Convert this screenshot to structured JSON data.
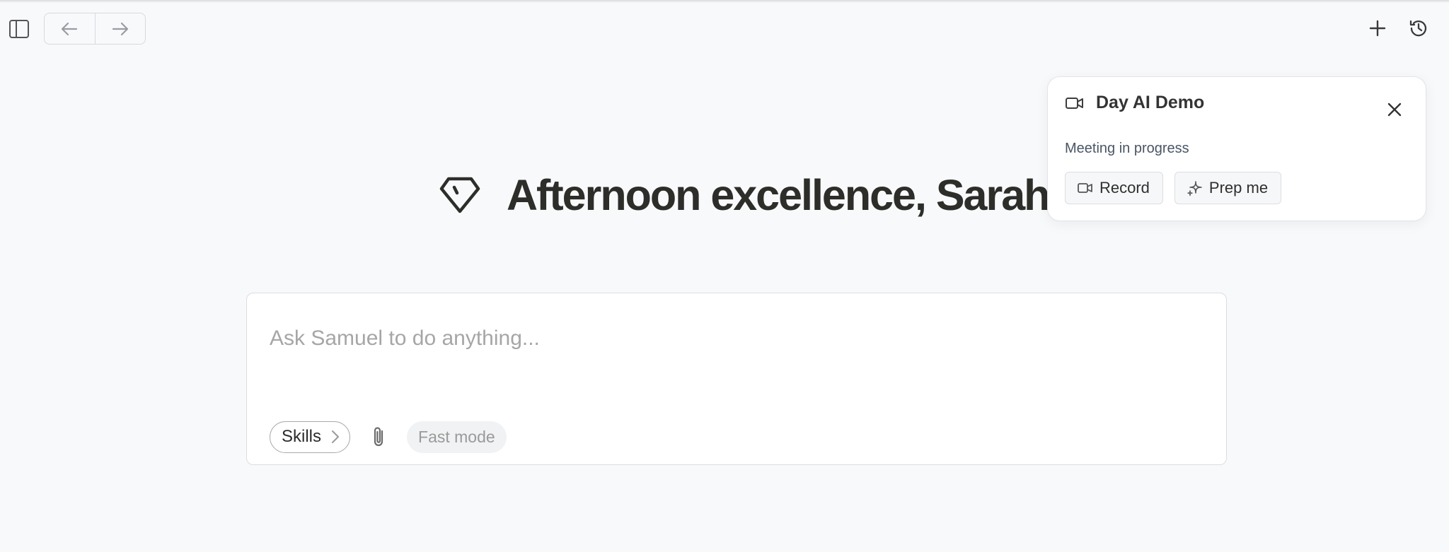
{
  "toolbar": {
    "sidebar_toggle_icon": "sidebar-panel-icon",
    "back_icon": "arrow-left-icon",
    "forward_icon": "arrow-right-icon",
    "new_icon": "plus-icon",
    "history_icon": "history-icon"
  },
  "greeting": {
    "icon": "diamond-icon",
    "title": "Afternoon excellence, Sarah"
  },
  "composer": {
    "placeholder": "Ask Samuel to do anything...",
    "value": "",
    "skills_label": "Skills",
    "attach_icon": "paperclip-icon",
    "fast_mode_label": "Fast mode"
  },
  "meeting_card": {
    "icon": "video-camera-icon",
    "title": "Day AI Demo",
    "status": "Meeting in progress",
    "record_label": "Record",
    "prep_label": "Prep me"
  },
  "colors": {
    "background": "#f8f9fb",
    "title_text": "#2d2d2a",
    "placeholder": "#a6a6a6",
    "muted": "#9a9a9a"
  }
}
